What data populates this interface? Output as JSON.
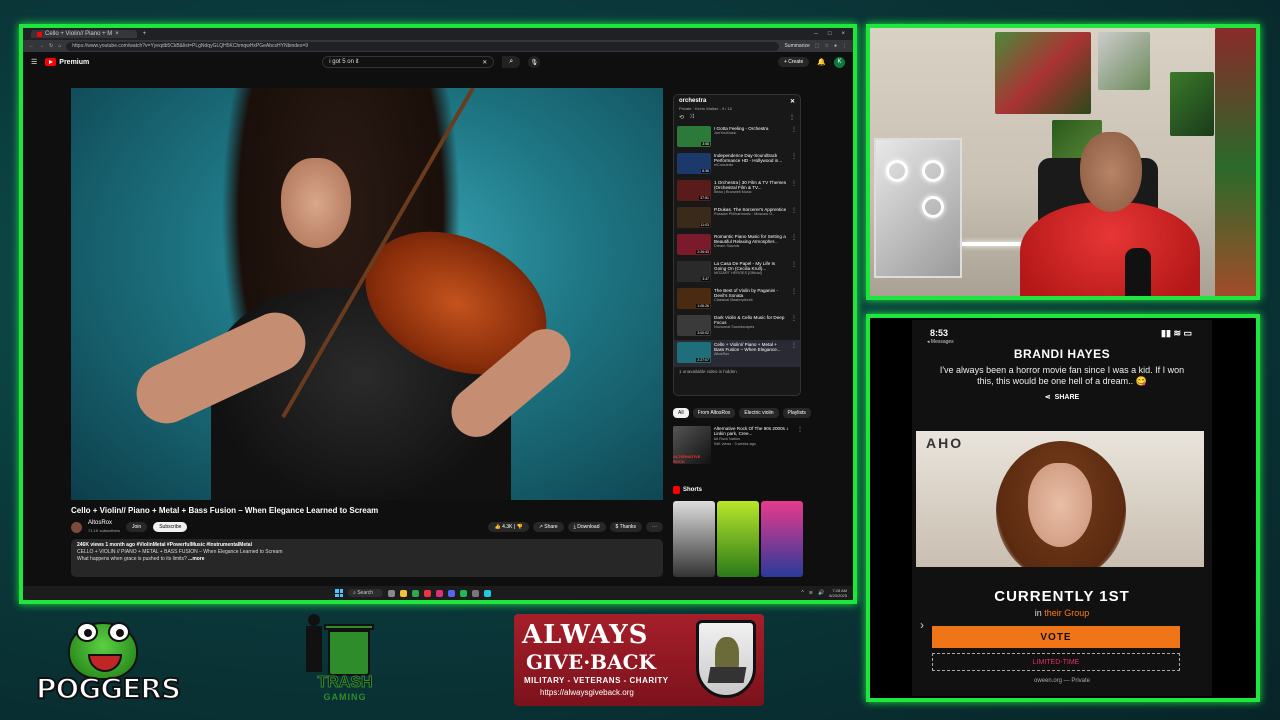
{
  "browser": {
    "tab_title": "Cello + Violin// Piano + M",
    "url": "https://www.youtube.com/watch?v=Yyeqdb5CkB&list=PLgNdqyGLQH5KChmqwHxPGeAbcsHYNbindex=9",
    "extension_label": "Summarize",
    "logo_text": "Premium",
    "search_value": "i got 5 on it",
    "create_label": "Create",
    "account_initial": "K"
  },
  "video": {
    "title": "Cello + Violin// Piano + Metal + Bass Fusion – When Elegance Learned to Scream",
    "channel": "AltosRox",
    "subscribers": "71.1K subscribers",
    "join": "Join",
    "subscribe": "Subscribe",
    "likes": "4.3K",
    "share": "Share",
    "download": "Download",
    "thanks": "Thanks",
    "description_meta": "246K views  1 month ago  #ViolinMetal #PowerfulMusic #InstrumentalMetal",
    "description_line2": "CELLO + VIOLIN // PIANO + METAL + BASS FUSION – When Elegance Learned to Scream",
    "description_line3": "What happens when grace is pushed to its limits?",
    "more": "...more"
  },
  "playlist": {
    "title": "orchestra",
    "meta": "Private  ·  Kevin Walker - 9 / 10",
    "items": [
      {
        "title": "I Gotta Feeling - Orchestra",
        "channel": "JonYouMusic",
        "duration": "3:58",
        "color": "#2b7a3a"
      },
      {
        "title": "Independence Day-Soundtrack Performance HD - Hollywood in...",
        "channel": "elConcierto",
        "duration": "6:36",
        "color": "#1b3a6b"
      },
      {
        "title": "1 Orchestra | 30 Film & TV Themes (Orchestral Film & TV...",
        "channel": "Beau | Brunwell Music",
        "duration": "37:51",
        "color": "#5a1b1b"
      },
      {
        "title": "P.Dukas. The Sorcerer's Apprentice",
        "channel": "Russian Philharmonic · Moscow O...",
        "duration": "11:03",
        "color": "#3a2a1a"
      },
      {
        "title": "Romantic Piano Music for Setting a Beautiful Relaxing Atmospher...",
        "channel": "Dream Sounds",
        "duration": "2:26:43",
        "color": "#7a1a2a"
      },
      {
        "title": "La Casa De Papel - My Life Is Going On (Cecilia Krull)...",
        "channel": "MOZART HEROES [Official]",
        "duration": "3:47",
        "color": "#2a2a2a"
      },
      {
        "title": "The Best of Violin by Paganini - Devil's Sonata",
        "channel": "Classical Masterpieces",
        "duration": "1:06:26",
        "color": "#4a2a10"
      },
      {
        "title": "Dark Violin & Cello Music for Deep Focus",
        "channel": "Nocturnal Soundscapes",
        "duration": "3:00:02",
        "color": "#3a3a3a"
      },
      {
        "title": "Cello + Violin// Piano + Metal + Bass Fusion – When Elegance...",
        "channel": "AltosRox",
        "duration": "2:27:07",
        "color": "#1f6f7a"
      }
    ],
    "hidden_note": "1 unavailable video is hidden"
  },
  "chips": [
    "All",
    "From AltosRox",
    "Electric violin",
    "Playlists"
  ],
  "recommendation": {
    "title": "Alternative Rock Of The 90s 2000s ♪ Linkin park, Cree...",
    "channel": "Alt Rock Nation",
    "meta": "94K views · 3 weeks ago",
    "thumb_label": "ALTERNATIVE ROCK"
  },
  "shorts_label": "Shorts",
  "taskbar": {
    "search": "Search",
    "time": "7:28 AM",
    "date": "8/20/2025"
  },
  "phone": {
    "time": "8:53",
    "back_label": "◂ Messages",
    "name": "BRANDI HAYES",
    "quote": "I've always been a horror movie fan since I was a kid. If I won this, this would be one hell of a dream..",
    "share": "SHARE",
    "photo_text": "AHO",
    "rank": "CURRENTLY 1ST",
    "in_text": "in",
    "group_text": "their Group",
    "vote": "VOTE",
    "limited": "LIMITED-TIME",
    "footer": "oween.org — Private"
  },
  "logos": {
    "poggers": "POGGERS",
    "trash_big": "TRASH",
    "trash_small": "GAMING",
    "agb_line1": "ALWAYS",
    "agb_line2": "GIVE·BACK",
    "agb_tag": "MILITARY - VETERANS - CHARITY",
    "agb_url": "https://alwaysgiveback.org"
  },
  "colors": {
    "frame_green": "#1ee63c",
    "youtube_red": "#ff0000",
    "vote_orange": "#f07418",
    "agb_red": "#a61f2a"
  }
}
